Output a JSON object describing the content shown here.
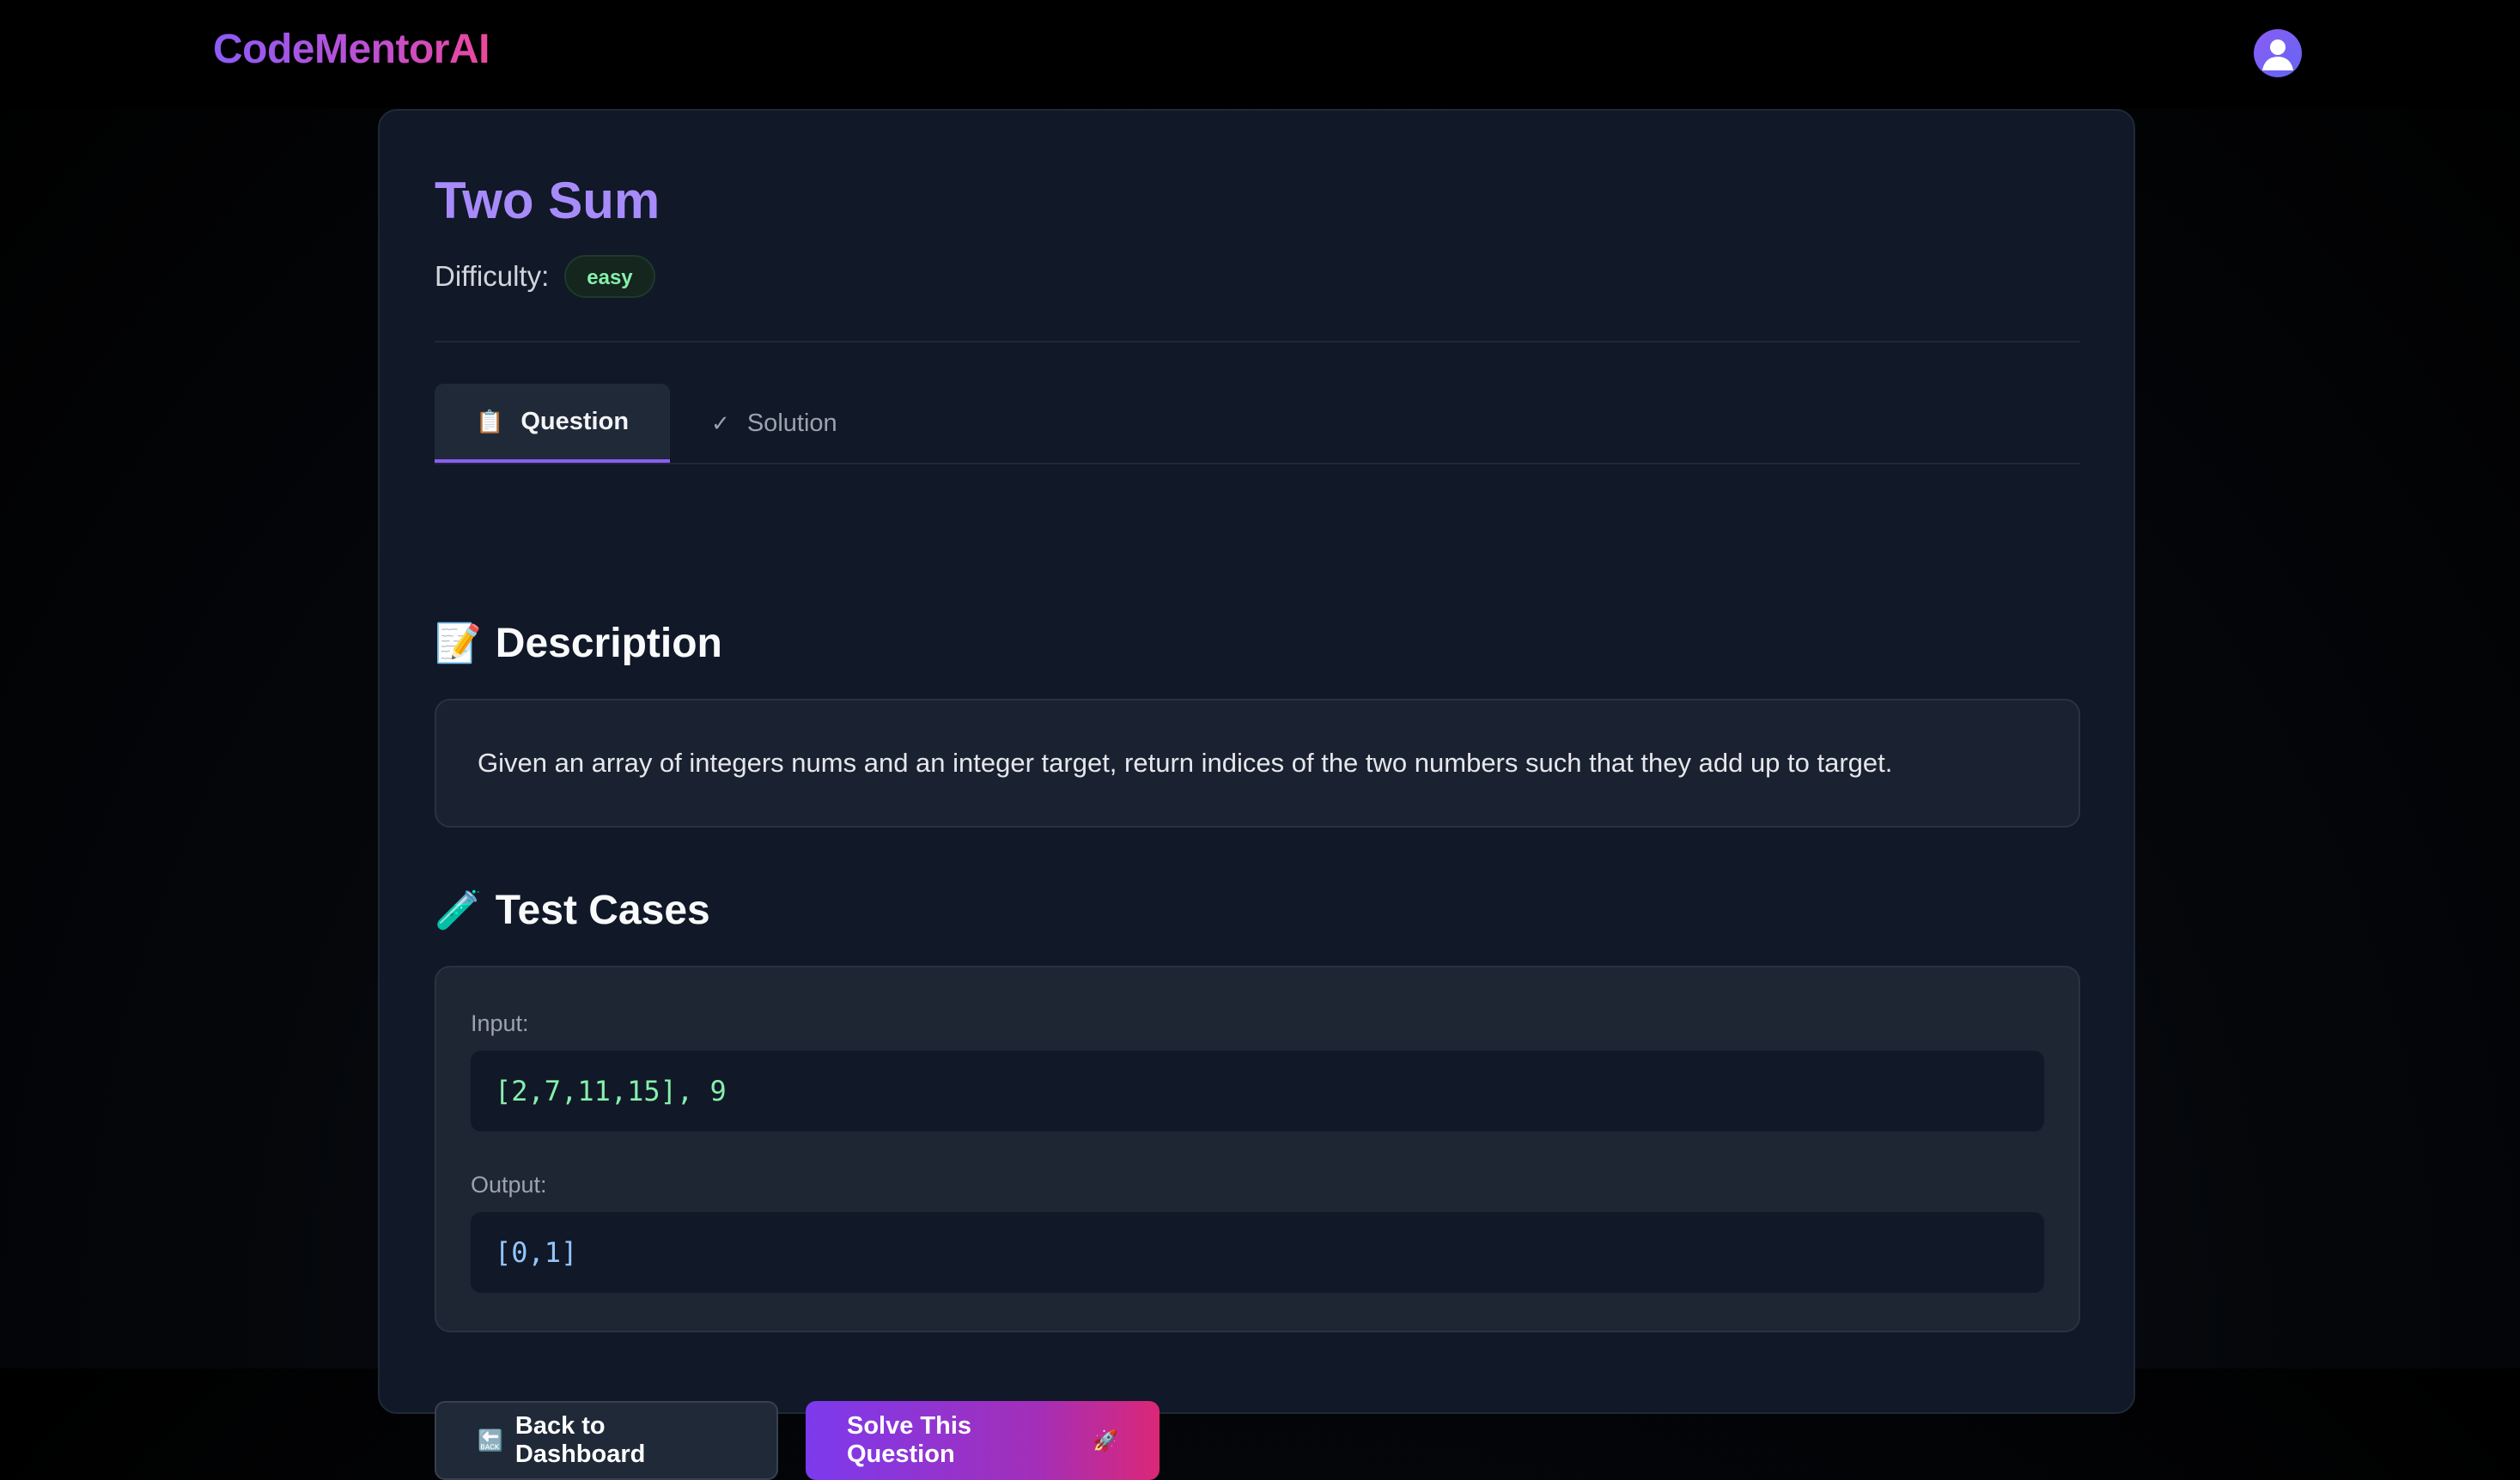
{
  "header": {
    "brand": "CodeMentorAI",
    "avatar_icon": "user-icon"
  },
  "question": {
    "title": "Two Sum",
    "difficulty_label": "Difficulty:",
    "difficulty": "easy"
  },
  "tabs": [
    {
      "label": "Question",
      "icon": "📋",
      "active": true
    },
    {
      "label": "Solution",
      "icon": "✓",
      "active": false
    }
  ],
  "description": {
    "heading": "Description",
    "icon": "📝",
    "text": "Given an array of integers nums and an integer target, return indices of the two numbers such that they add up to target."
  },
  "test_cases": {
    "heading": "Test Cases",
    "icon": "🧪",
    "input_label": "Input:",
    "input_value": "[2,7,11,15], 9",
    "output_label": "Output:",
    "output_value": "[0,1]"
  },
  "actions": {
    "back_label": "Back to Dashboard",
    "back_icon": "🔙",
    "solve_label": "Solve This Question",
    "solve_icon": "🚀"
  },
  "colors": {
    "accent": "#8b5cf6",
    "brand_gradient_end": "#ec4899",
    "badge_text": "#86efac",
    "output_text": "#93c5fd"
  }
}
